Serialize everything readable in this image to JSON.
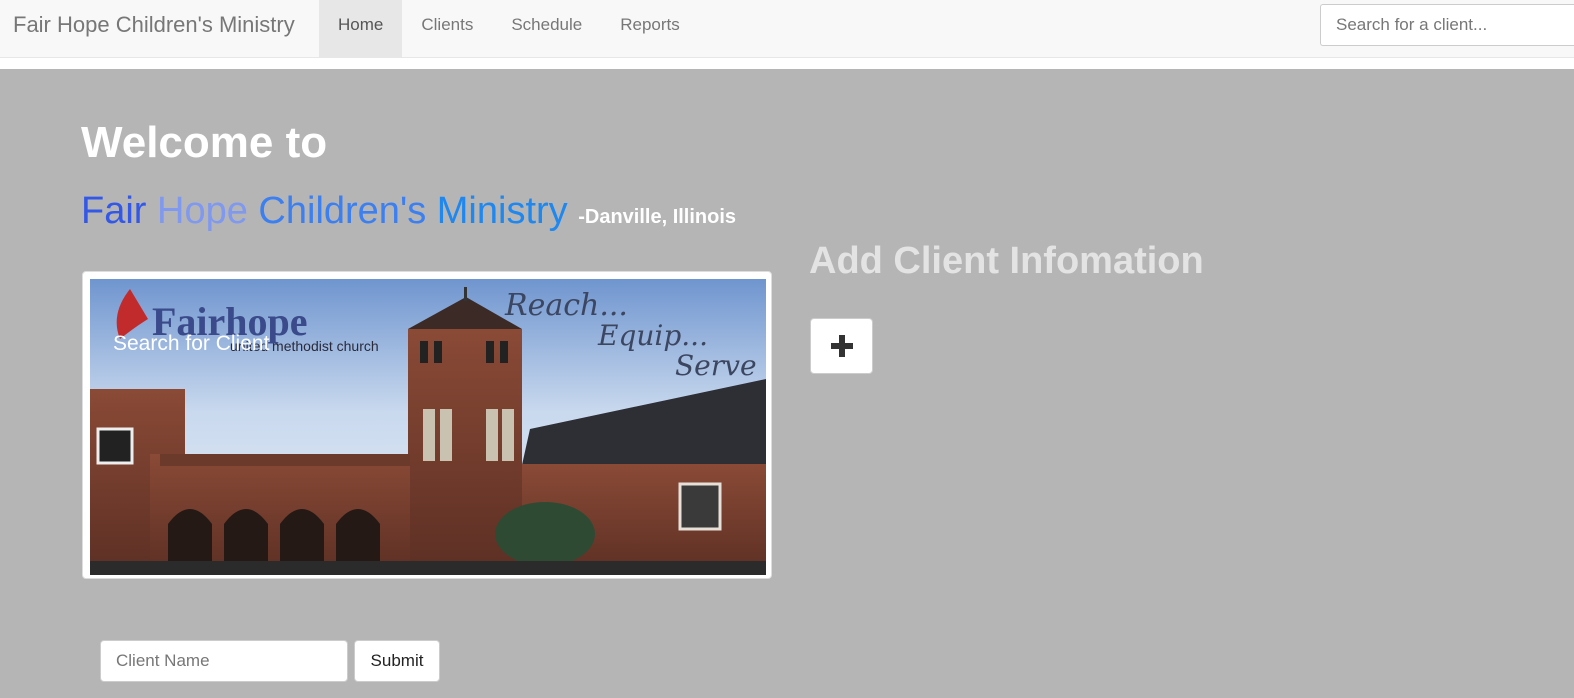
{
  "navbar": {
    "brand": "Fair Hope Children's Ministry",
    "items": [
      {
        "label": "Home",
        "active": true
      },
      {
        "label": "Clients",
        "active": false
      },
      {
        "label": "Schedule",
        "active": false
      },
      {
        "label": "Reports",
        "active": false
      }
    ],
    "search_placeholder": "Search for a client..."
  },
  "hero": {
    "welcome": "Welcome to",
    "ministry_words": [
      "Fair",
      "Hope",
      "Children's",
      "Ministry"
    ],
    "location": "-Danville, Illinois",
    "photo_caption": "Search for Client",
    "photo": {
      "logo_text": "Fairhope",
      "logo_subtext": "united methodist church",
      "tagline": [
        "Reach...",
        "Equip...",
        "Serve"
      ]
    }
  },
  "add_client": {
    "title": "Add Client Infomation",
    "button_icon": "plus-icon"
  },
  "client_form": {
    "name_placeholder": "Client Name",
    "submit_label": "Submit"
  },
  "colors": {
    "background": "#b5b5b5",
    "fair": "#3358e8",
    "hope": "#7f98f0",
    "childrens": "#3b7ff0",
    "ministry": "#1e88f0"
  }
}
